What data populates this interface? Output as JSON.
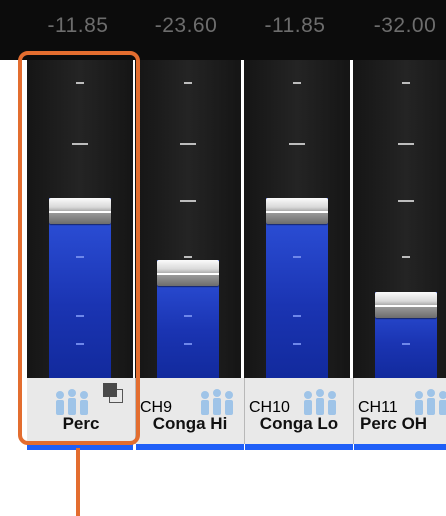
{
  "colors": {
    "accent_orange": "#e36d2f",
    "fader_blue": "#1f44c8",
    "select_blue": "#1f5ff7",
    "value_text": "#6d6d6d"
  },
  "channels": [
    {
      "value": "-11.85",
      "ch_label": "",
      "name": "Perc",
      "level": 0.566,
      "icon": "drum-players-icon",
      "selected": true,
      "has_assign_icon": true
    },
    {
      "value": "-23.60",
      "ch_label": "CH9",
      "name": "Conga Hi",
      "level": 0.37,
      "icon": "drum-players-icon",
      "selected": false
    },
    {
      "value": "-11.85",
      "ch_label": "CH10",
      "name": "Conga Lo",
      "level": 0.566,
      "icon": "drum-players-icon",
      "selected": false
    },
    {
      "value": "-32.00",
      "ch_label": "CH11",
      "name": "Perc OH",
      "level": 0.27,
      "icon": "drum-players-icon",
      "selected": false
    }
  ]
}
